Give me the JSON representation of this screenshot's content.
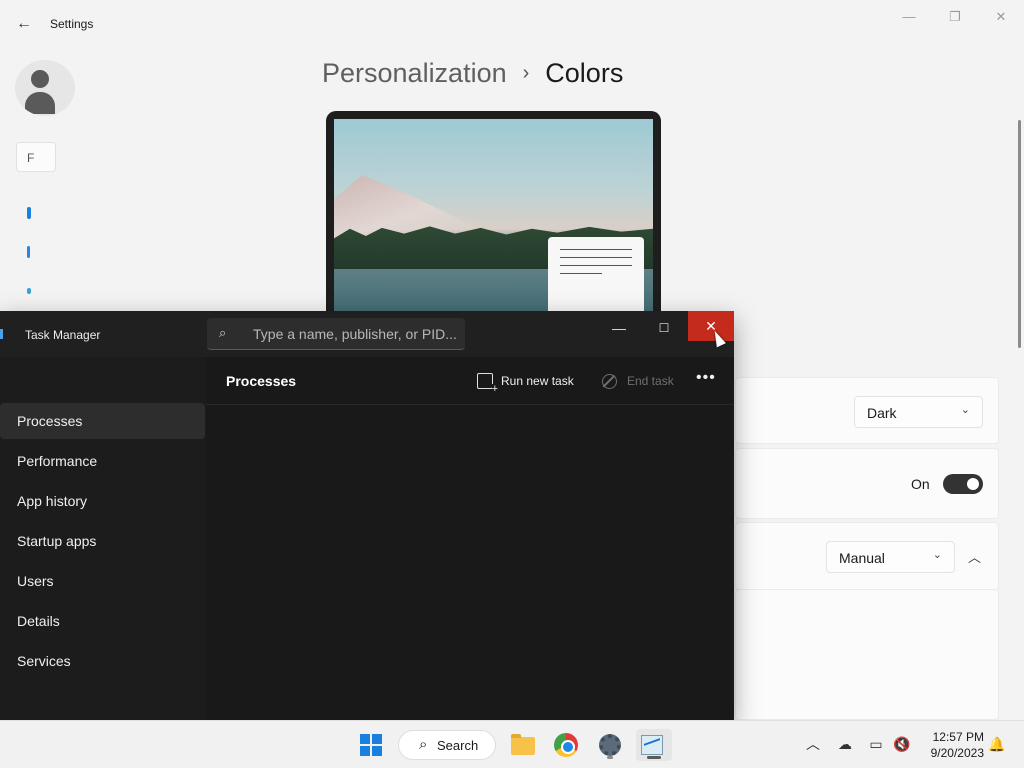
{
  "settings": {
    "window_title": "Settings",
    "search_placeholder_visible": "F",
    "breadcrumb": {
      "parent": "Personalization",
      "separator": "›",
      "current": "Colors"
    },
    "mode_value": "Dark",
    "transparency_state": "On",
    "accent_value": "Manual"
  },
  "task_manager": {
    "title": "Task Manager",
    "search_placeholder": "Type a name, publisher, or PID...",
    "nav_items": [
      "Processes",
      "Performance",
      "App history",
      "Startup apps",
      "Users",
      "Details",
      "Services"
    ],
    "active_nav": "Processes",
    "page_title": "Processes",
    "run_new_task_label": "Run new task",
    "end_task_label": "End task",
    "more_label": "•••"
  },
  "taskbar": {
    "search_label": "Search",
    "time": "12:57 PM",
    "date": "9/20/2023",
    "apps": [
      "start-icon",
      "file-explorer-icon",
      "chrome-icon",
      "settings-icon",
      "task-manager-icon"
    ]
  },
  "colors": {
    "close_hover": "#c42b1c",
    "taskmgr_bg": "#1c1c1c",
    "accent_blue": "#1a80e0"
  }
}
